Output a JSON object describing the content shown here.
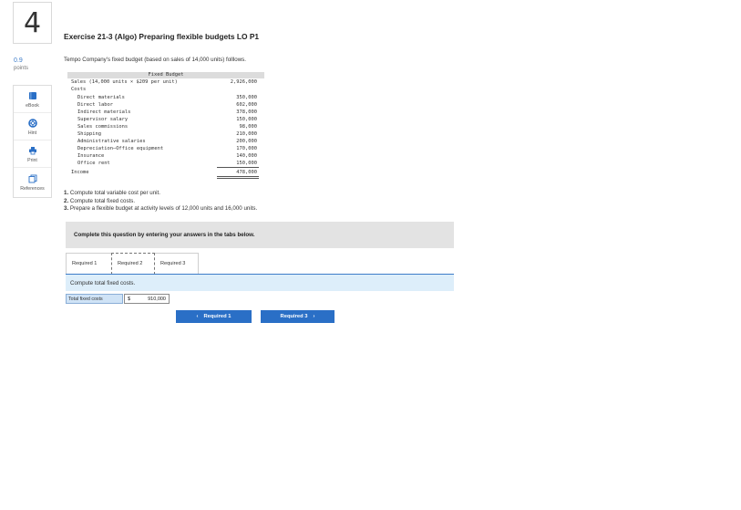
{
  "question": {
    "number": "4"
  },
  "points": {
    "value": "0.9",
    "label": "points"
  },
  "tools": [
    {
      "label": "eBook",
      "icon": "book-icon"
    },
    {
      "label": "Hint",
      "icon": "lifebuoy-icon"
    },
    {
      "label": "Print",
      "icon": "printer-icon"
    },
    {
      "label": "References",
      "icon": "references-icon"
    }
  ],
  "title": "Exercise 21-3 (Algo) Preparing flexible budgets LO P1",
  "intro": "Tempo Company's fixed budget (based on sales of 14,000 units) folllows.",
  "budget": {
    "header": "Fixed Budget",
    "sales_label": "Sales (14,000 units × $209 per unit)",
    "sales_value": "2,926,000",
    "costs_label": "Costs",
    "costs": [
      {
        "label": "Direct materials",
        "value": "350,000"
      },
      {
        "label": "Direct labor",
        "value": "602,000"
      },
      {
        "label": "Indirect materials",
        "value": "378,000"
      },
      {
        "label": "Supervisor salary",
        "value": "150,000"
      },
      {
        "label": "Sales commissions",
        "value": "98,000"
      },
      {
        "label": "Shipping",
        "value": "210,000"
      },
      {
        "label": "Administrative salaries",
        "value": "200,000"
      },
      {
        "label": "Depreciation—Office equipment",
        "value": "170,000"
      },
      {
        "label": "Insurance",
        "value": "140,000"
      },
      {
        "label": "Office rent",
        "value": "150,000"
      }
    ],
    "income_label": "Income",
    "income_value": "478,000"
  },
  "instructions": [
    {
      "num": "1.",
      "text": " Compute total variable cost per unit."
    },
    {
      "num": "2.",
      "text": " Compute total fixed costs."
    },
    {
      "num": "3.",
      "text": " Prepare a flexible budget at activity levels of 12,000 units and 16,000 units."
    }
  ],
  "complete_text": "Complete this question by entering your answers in the tabs below.",
  "tabs": [
    "Required 1",
    "Required 2",
    "Required 3"
  ],
  "task": "Compute total fixed costs.",
  "answer": {
    "label": "Total fixed costs",
    "currency": "$",
    "value": "910,000"
  },
  "nav": {
    "prev": "Required 1",
    "next": "Required 3"
  }
}
